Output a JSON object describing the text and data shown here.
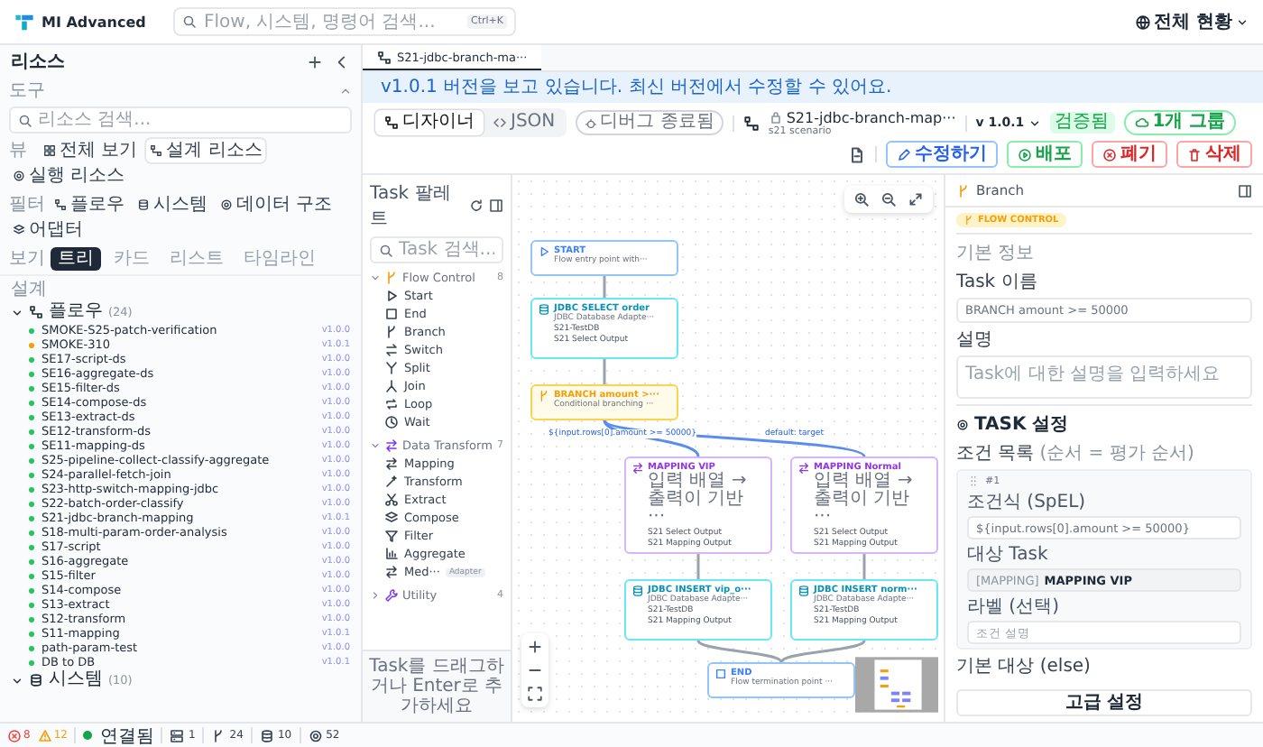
{
  "header": {
    "logo": "MI Advanced",
    "search": {
      "placeholder": "Flow, 시스템, 명령어 검색...",
      "shortcut": "Ctrl+K"
    },
    "workspace": "전체 현황"
  },
  "sidebar": {
    "title": "리소스",
    "tools_label": "도구",
    "search": {
      "placeholder": "리소스 검색..."
    },
    "scope": {
      "label": "뷰",
      "chips": [
        {
          "label": "전체 보기",
          "selected": false
        },
        {
          "label": "설계 리소스",
          "selected": true
        },
        {
          "label": "실행 리소스",
          "selected": false
        }
      ]
    },
    "filter": {
      "label": "필터",
      "chips": [
        {
          "label": "플로우"
        },
        {
          "label": "시스템"
        },
        {
          "label": "데이터 구조"
        },
        {
          "label": "어댑터"
        }
      ]
    },
    "view": {
      "label": "보기",
      "tabs": [
        {
          "label": "트리",
          "selected": true
        },
        {
          "label": "카드",
          "selected": false
        },
        {
          "label": "리스트",
          "selected": false
        },
        {
          "label": "타임라인",
          "selected": false
        }
      ]
    },
    "section": "설계",
    "folders": [
      {
        "name": "플로우",
        "count": "(24)",
        "expanded": true,
        "items": [
          {
            "name": "SMOKE-S25-patch-verification",
            "version": "v1.0.0",
            "color": "#22c55e"
          },
          {
            "name": "SMOKE-310",
            "version": "v1.0.1",
            "color": "#f59e0b"
          },
          {
            "name": "SE17-script-ds",
            "version": "v1.0.0",
            "color": "#22c55e"
          },
          {
            "name": "SE16-aggregate-ds",
            "version": "v1.0.0",
            "color": "#22c55e"
          },
          {
            "name": "SE15-filter-ds",
            "version": "v1.0.0",
            "color": "#22c55e"
          },
          {
            "name": "SE14-compose-ds",
            "version": "v1.0.0",
            "color": "#22c55e"
          },
          {
            "name": "SE13-extract-ds",
            "version": "v1.0.0",
            "color": "#22c55e"
          },
          {
            "name": "SE12-transform-ds",
            "version": "v1.0.0",
            "color": "#22c55e"
          },
          {
            "name": "SE11-mapping-ds",
            "version": "v1.0.0",
            "color": "#22c55e"
          },
          {
            "name": "S25-pipeline-collect-classify-aggregate",
            "version": "v1.0.0",
            "color": "#22c55e"
          },
          {
            "name": "S24-parallel-fetch-join",
            "version": "v1.0.0",
            "color": "#22c55e"
          },
          {
            "name": "S23-http-switch-mapping-jdbc",
            "version": "v1.0.0",
            "color": "#22c55e"
          },
          {
            "name": "S22-batch-order-classify",
            "version": "v1.0.0",
            "color": "#22c55e"
          },
          {
            "name": "S21-jdbc-branch-mapping",
            "version": "v1.0.1",
            "color": "#22c55e"
          },
          {
            "name": "S18-multi-param-order-analysis",
            "version": "v1.0.0",
            "color": "#22c55e"
          },
          {
            "name": "S17-script",
            "version": "v1.0.0",
            "color": "#22c55e"
          },
          {
            "name": "S16-aggregate",
            "version": "v1.0.0",
            "color": "#22c55e"
          },
          {
            "name": "S15-filter",
            "version": "v1.0.0",
            "color": "#22c55e"
          },
          {
            "name": "S14-compose",
            "version": "v1.0.0",
            "color": "#22c55e"
          },
          {
            "name": "S13-extract",
            "version": "v1.0.0",
            "color": "#22c55e"
          },
          {
            "name": "S12-transform",
            "version": "v1.0.0",
            "color": "#22c55e"
          },
          {
            "name": "S11-mapping",
            "version": "v1.0.1",
            "color": "#22c55e"
          },
          {
            "name": "path-param-test",
            "version": "v1.0.0",
            "color": "#22c55e"
          },
          {
            "name": "DB to DB",
            "version": "v1.0.1",
            "color": "#22c55e"
          }
        ]
      },
      {
        "name": "시스템",
        "count": "(10)",
        "expanded": true
      }
    ]
  },
  "editor": {
    "tab": {
      "label": "S21-jdbc-branch-ma···",
      "selected": true
    },
    "banner": "v1.0.1 버전을 보고 있습니다. 최신 버전에서 수정할 수 있어요.",
    "toolbar": {
      "modes": [
        {
          "label": "디자이너",
          "selected": true
        },
        {
          "label": "JSON",
          "selected": false
        }
      ],
      "debug": "디버그 종료됨",
      "flow_title": "S21-jdbc-branch-map···",
      "flow_subtitle": "s21 scenario",
      "version": "v 1.0.1",
      "status": "검증됨",
      "groups": "1개 그룹",
      "actions": [
        {
          "label": "수정하기",
          "kind": "edit"
        },
        {
          "label": "배포",
          "kind": "deploy"
        },
        {
          "label": "폐기",
          "kind": "discard"
        },
        {
          "label": "삭제",
          "kind": "delete"
        }
      ]
    },
    "palette": {
      "title": "Task 팔레트",
      "search": {
        "placeholder": "Task 검색..."
      },
      "categories": [
        {
          "name": "Flow Control",
          "count": "8",
          "expanded": true,
          "items": [
            {
              "name": "Start"
            },
            {
              "name": "End"
            },
            {
              "name": "Branch"
            },
            {
              "name": "Switch"
            },
            {
              "name": "Split"
            },
            {
              "name": "Join"
            },
            {
              "name": "Loop"
            },
            {
              "name": "Wait"
            }
          ]
        },
        {
          "name": "Data Transform",
          "count": "7",
          "expanded": true,
          "items": [
            {
              "name": "Mapping"
            },
            {
              "name": "Transform"
            },
            {
              "name": "Extract"
            },
            {
              "name": "Compose"
            },
            {
              "name": "Filter"
            },
            {
              "name": "Aggregate"
            },
            {
              "name": "Med···",
              "tag": "Adapter"
            }
          ]
        },
        {
          "name": "Utility",
          "count": "4",
          "expanded": false
        }
      ],
      "hint": "Task를 드래그하거나 Enter로 추가하세요"
    },
    "canvas": {
      "nodes": [
        {
          "kind": "start",
          "title": "START",
          "subtitle": "Flow entry point with···"
        },
        {
          "kind": "jdbc",
          "title": "JDBC SELECT order",
          "subtitle": "JDBC Database Adapte···",
          "details": [
            "S21-TestDB",
            "S21 Select Output"
          ]
        },
        {
          "kind": "branch",
          "title": "BRANCH amount >···",
          "subtitle": "Conditional branching ···"
        },
        {
          "kind": "mapping",
          "title": "MAPPING VIP",
          "subtitle": "입력 배열 → 출력이 기반 ···",
          "details": [
            "S21 Select Output",
            "S21 Mapping Output"
          ]
        },
        {
          "kind": "mapping",
          "title": "MAPPING Normal",
          "subtitle": "입력 배열 → 출력이 기반 ···",
          "details": [
            "S21 Select Output",
            "S21 Mapping Output"
          ]
        },
        {
          "kind": "jdbc",
          "title": "JDBC INSERT vip_o···",
          "subtitle": "JDBC Database Adapte···",
          "details": [
            "S21-TestDB",
            "S21 Mapping Output"
          ]
        },
        {
          "kind": "jdbc",
          "title": "JDBC INSERT norm···",
          "subtitle": "JDBC Database Adapte···",
          "details": [
            "S21-TestDB",
            "S21 Mapping Output"
          ]
        },
        {
          "kind": "end",
          "title": "END",
          "subtitle": "Flow termination point ···"
        }
      ],
      "edge_labels": [
        "${input.rows[0].amount >= 50000}",
        "default: target"
      ]
    },
    "inspector": {
      "title": "Branch",
      "category": "FLOW CONTROL",
      "basic_label": "기본 정보",
      "name_field": {
        "label": "Task 이름",
        "value": "BRANCH amount >= 50000"
      },
      "description_field": {
        "label": "설명",
        "placeholder": "Task에 대한 설명을 입력하세요"
      },
      "settings_label": "TASK 설정",
      "conditions_label": "조건 목록",
      "conditions_hint": "(순서 = 평가 순서)",
      "conditions": [
        {
          "index": "#1",
          "expression_label": "조건식 (SpEL)",
          "expression": "${input.rows[0].amount >= 50000}",
          "target_label": "대상 Task",
          "target_kind": "[MAPPING]",
          "target": "MAPPING VIP",
          "label_label": "라벨 (선택)",
          "label_placeholder": "조건 설명"
        }
      ],
      "default_label": "기본 대상 (else)",
      "advanced_button": "고급 설정"
    }
  },
  "status_bar": {
    "errors": "8",
    "warnings": "12",
    "connection": "연결됨",
    "connected": true,
    "counts": [
      "1",
      "24",
      "10",
      "52"
    ]
  }
}
